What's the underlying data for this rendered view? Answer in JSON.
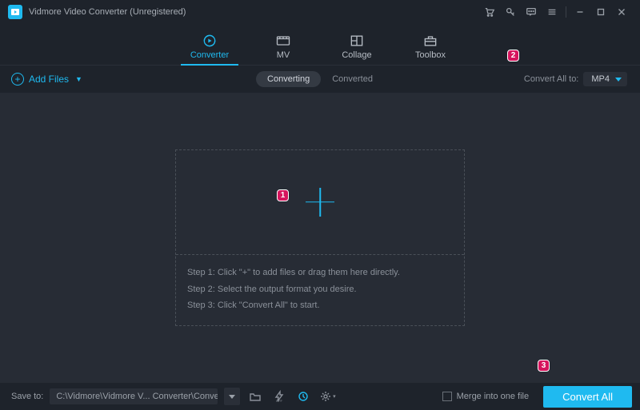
{
  "title": "Vidmore Video Converter (Unregistered)",
  "tabs": {
    "converter": "Converter",
    "mv": "MV",
    "collage": "Collage",
    "toolbox": "Toolbox"
  },
  "subbar": {
    "add_files": "Add Files",
    "converting": "Converting",
    "converted": "Converted",
    "convert_all_to": "Convert All to:",
    "format": "MP4"
  },
  "drop": {
    "step1": "Step 1: Click \"+\" to add files or drag them here directly.",
    "step2": "Step 2: Select the output format you desire.",
    "step3": "Step 3: Click \"Convert All\" to start."
  },
  "bottom": {
    "save_to": "Save to:",
    "path": "C:\\Vidmore\\Vidmore V... Converter\\Converted",
    "merge": "Merge into one file",
    "convert_all": "Convert All"
  },
  "markers": {
    "m1": "1",
    "m2": "2",
    "m3": "3"
  }
}
